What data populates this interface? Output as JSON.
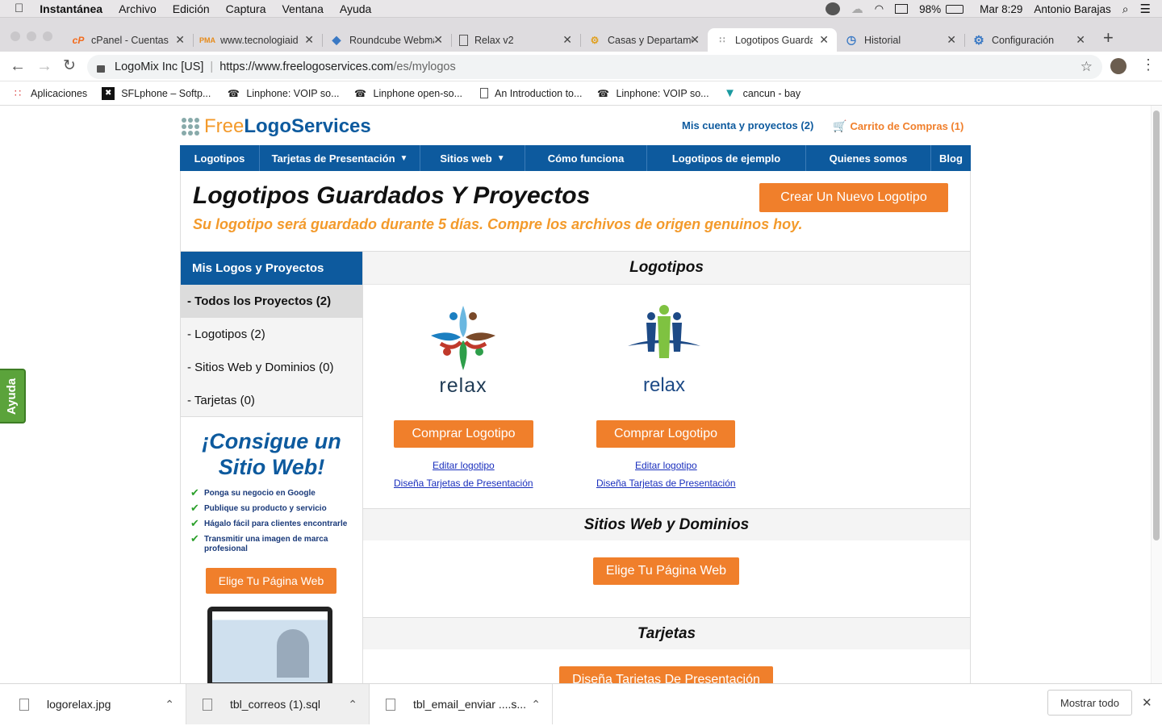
{
  "menubar": {
    "app": "Instantánea",
    "items": [
      "Archivo",
      "Edición",
      "Captura",
      "Ventana",
      "Ayuda"
    ],
    "battery": "98%",
    "clock": "Mar 8:29",
    "user": "Antonio Barajas"
  },
  "tabs": [
    {
      "title": "cPanel - Cuentas",
      "icon": "cpanel-icon"
    },
    {
      "title": "www.tecnologiaid",
      "icon": "phpmyadmin-icon"
    },
    {
      "title": "Roundcube Webmail",
      "icon": "roundcube-icon"
    },
    {
      "title": "Relax v2",
      "icon": "document-icon"
    },
    {
      "title": "Casas y Departamentos",
      "icon": "casas-icon"
    },
    {
      "title": "Logotipos Guardados",
      "icon": "grid-icon"
    },
    {
      "title": "Historial",
      "icon": "history-icon"
    },
    {
      "title": "Configuración",
      "icon": "gear-icon"
    }
  ],
  "address": {
    "site_id": "LogoMix Inc [US]",
    "url_host": "https://www.freelogoservices.com",
    "url_path": "/es/mylogos"
  },
  "bookmarks": [
    {
      "label": "Aplicaciones",
      "icon": "apps-grid-icon"
    },
    {
      "label": "SFLphone – Softp...",
      "icon": "sflphone-icon"
    },
    {
      "label": "Linphone: VOIP so...",
      "icon": "linphone-icon"
    },
    {
      "label": "Linphone open-so...",
      "icon": "linphone-icon"
    },
    {
      "label": "An Introduction to...",
      "icon": "document-icon"
    },
    {
      "label": "Linphone: VOIP so...",
      "icon": "linphone-icon"
    },
    {
      "label": "cancun - bay",
      "icon": "cancun-icon"
    }
  ],
  "site": {
    "logo_free": "Free",
    "logo_rest": "LogoServices",
    "account_link": "Mis cuenta y proyectos (2)",
    "cart_link": "Carrito de Compras (1)",
    "nav": [
      "Logotipos",
      "Tarjetas de Presentación",
      "Sitios web",
      "Cómo funciona",
      "Logotipos de ejemplo",
      "Quienes somos",
      "Blog"
    ],
    "page_title": "Logotipos Guardados Y Proyectos",
    "subtitle": "Su logotipo será guardado durante 5 días. Compre los archivos de origen genuinos hoy.",
    "create_button": "Crear Un Nuevo Logotipo",
    "sidebar": {
      "header": "Mis Logos y Proyectos",
      "items": [
        "- Todos los Proyectos (2)",
        "- Logotipos (2)",
        "- Sitios Web y Dominios (0)",
        "- Tarjetas (0)"
      ],
      "promo_title_1": "¡Consigue un",
      "promo_title_2": "Sitio Web!",
      "checks": [
        "Ponga su negocio en Google",
        "Publique su producto y servicio",
        "Hágalo fácil para clientes encontrarle",
        "Transmitir una imagen de marca profesional"
      ],
      "promo_button": "Elige Tu Página Web"
    },
    "sections": {
      "logos": "Logotipos",
      "websites": "Sitios Web y Dominios",
      "cards": "Tarjetas"
    },
    "logos": [
      {
        "text": "relax",
        "buy": "Comprar Logotipo",
        "edit": "Editar logotipo",
        "cards": "Diseña Tarjetas de Presentación"
      },
      {
        "text": "relax",
        "buy": "Comprar Logotipo",
        "edit": "Editar logotipo",
        "cards": "Diseña Tarjetas de Presentación"
      }
    ],
    "website_button": "Elige Tu Página Web",
    "cards_button": "Diseña Tarjetas De Presentación",
    "help_tab": "Ayuda"
  },
  "downloads": {
    "files": [
      "logorelax.jpg",
      "tbl_correos (1).sql",
      "tbl_email_enviar ....s..."
    ],
    "show_all": "Mostrar todo"
  }
}
